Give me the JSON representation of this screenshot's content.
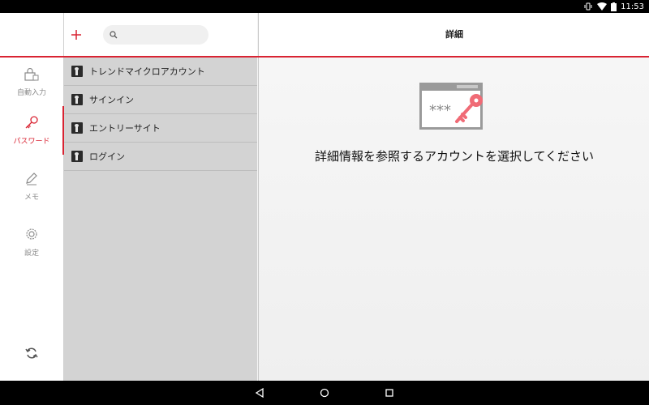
{
  "status_bar": {
    "time": "11:53",
    "icons": [
      "vibrate-icon",
      "wifi-icon",
      "battery-icon"
    ]
  },
  "sidebar": {
    "items": [
      {
        "label": "自動入力",
        "icon": "autofill-lock-icon",
        "active": false
      },
      {
        "label": "パスワード",
        "icon": "key-icon",
        "active": true
      },
      {
        "label": "メモ",
        "icon": "pencil-icon",
        "active": false
      },
      {
        "label": "設定",
        "icon": "gear-icon",
        "active": false
      }
    ],
    "sync_icon": "sync-icon"
  },
  "list_panel": {
    "add_icon": "plus-icon",
    "search": {
      "icon": "search-icon",
      "value": "",
      "placeholder": ""
    },
    "items": [
      {
        "label": "トレンドマイクロアカウント",
        "icon": "keyhole-icon"
      },
      {
        "label": "サインイン",
        "icon": "keyhole-icon"
      },
      {
        "label": "エントリーサイト",
        "icon": "keyhole-icon"
      },
      {
        "label": "ログイン",
        "icon": "keyhole-icon"
      }
    ]
  },
  "detail": {
    "title": "詳細",
    "illustration_text": "***",
    "empty_message": "詳細情報を参照するアカウントを選択してください"
  },
  "nav_bar": {
    "buttons": [
      "back-icon",
      "home-icon",
      "recents-icon"
    ]
  },
  "colors": {
    "accent": "#d92332",
    "list_bg": "#d3d3d3",
    "rail_bg": "#ffffff",
    "illustration_key": "#f06b76"
  }
}
